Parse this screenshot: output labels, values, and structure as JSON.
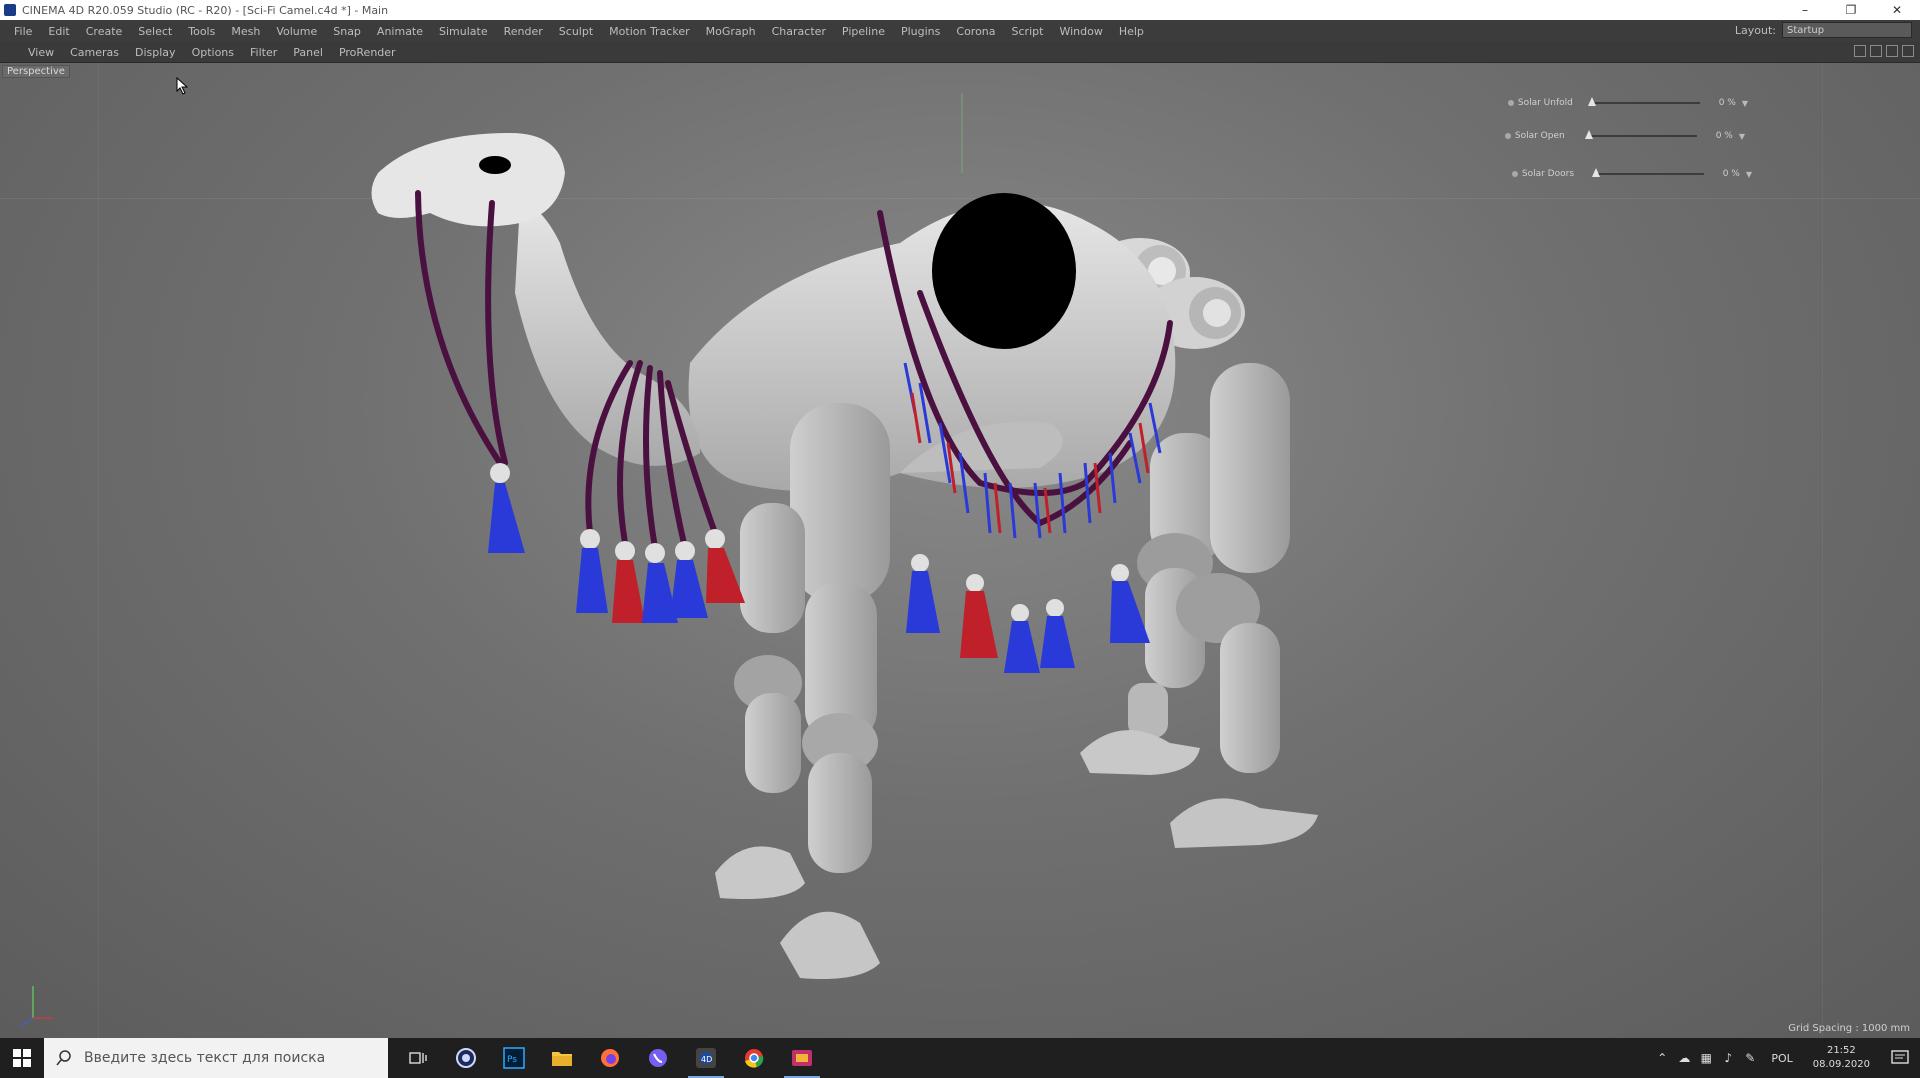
{
  "window": {
    "title": "CINEMA 4D R20.059 Studio (RC - R20) - [Sci-Fi Camel.c4d *] - Main",
    "controls": [
      "–",
      "❐",
      "✕"
    ]
  },
  "menubar": {
    "items": [
      "File",
      "Edit",
      "Create",
      "Select",
      "Tools",
      "Mesh",
      "Volume",
      "Snap",
      "Animate",
      "Simulate",
      "Render",
      "Sculpt",
      "Motion Tracker",
      "MoGraph",
      "Character",
      "Pipeline",
      "Plugins",
      "Corona",
      "Script",
      "Window",
      "Help"
    ],
    "layout_label": "Layout:",
    "layout_value": "Startup"
  },
  "viewport_menu": {
    "items": [
      "View",
      "Cameras",
      "Display",
      "Options",
      "Filter",
      "Panel",
      "ProRender"
    ]
  },
  "viewport": {
    "camera_label": "Perspective",
    "grid_spacing": "Grid Spacing : 1000 mm",
    "sliders": [
      {
        "label": "Solar Unfold",
        "value": "0 %",
        "level": 0
      },
      {
        "label": "Solar Open",
        "value": "0 %",
        "level": 0
      },
      {
        "label": "Solar Doors",
        "value": "0 %",
        "level": 0
      }
    ]
  },
  "taskbar": {
    "search_placeholder": "Введите здесь текст для поиска",
    "apps": [
      "task-view-icon",
      "cortana-icon",
      "photoshop-icon",
      "file-explorer-icon",
      "firefox-icon",
      "viber-icon",
      "cinema4d-icon",
      "chrome-icon",
      "media-icon"
    ],
    "language": "POL",
    "time": "21:52",
    "date": "08.09.2020"
  },
  "colors": {
    "rope": "#4a1040",
    "tassel_blue": "#2a3ad8",
    "tassel_red": "#c0202a",
    "body": "#d6d6d6"
  }
}
